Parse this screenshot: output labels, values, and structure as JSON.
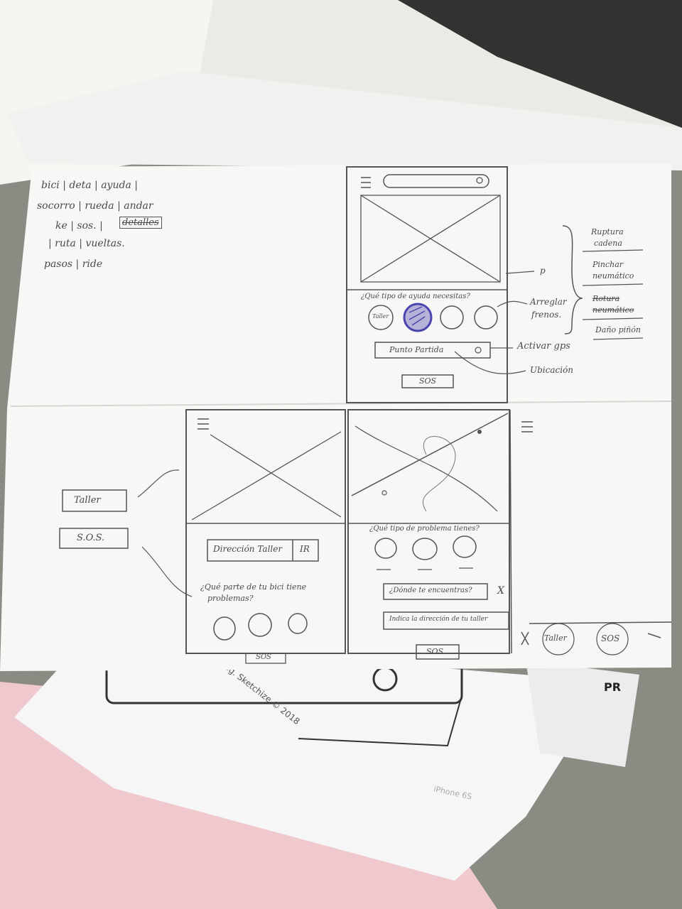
{
  "brainstorm": {
    "line1": "bici | deta | ayuda |",
    "line2": "socorro | rueda | andar",
    "line3": "ke | sos. |",
    "line3_crossed": "detalles",
    "line4": "| ruta | vueltas.",
    "line5": "pasos | ride"
  },
  "screen1": {
    "question": "¿Qué tipo de ayuda necesitas?",
    "circle1": "Taller",
    "point_button": "Punto Partida",
    "sos_button": "SOS"
  },
  "annotations": {
    "p": "p",
    "arreglar1": "Arreglar",
    "arreglar2": "frenos.",
    "activar": "Activar gps",
    "ubicacion": "Ubicación"
  },
  "problems": {
    "item1a": "Ruptura",
    "item1b": "cadena",
    "item2a": "Pinchar",
    "item2b": "neumático",
    "item3a": "Rotura",
    "item3b": "neumático",
    "item4": "Daño piñón"
  },
  "flow": {
    "taller": "Taller",
    "sos": "S.O.S."
  },
  "screen2": {
    "address": "Dirección Taller",
    "go": "IR",
    "question1": "¿Qué parte de tu bici tiene",
    "question2": "problemas?",
    "sos": "SOS"
  },
  "screen3": {
    "question": "¿Qué tipo de problema tienes?",
    "where": "¿Dónde te encuentras?",
    "close": "X",
    "address": "Indica la dirección de tu taller",
    "sos": "SOS"
  },
  "screen4": {
    "tab2": "Taller",
    "tab3": "SOS"
  },
  "background_paper": {
    "credit": "ching. Sketchize © 2018",
    "device": "iPhone 6S",
    "corner": "PR"
  }
}
